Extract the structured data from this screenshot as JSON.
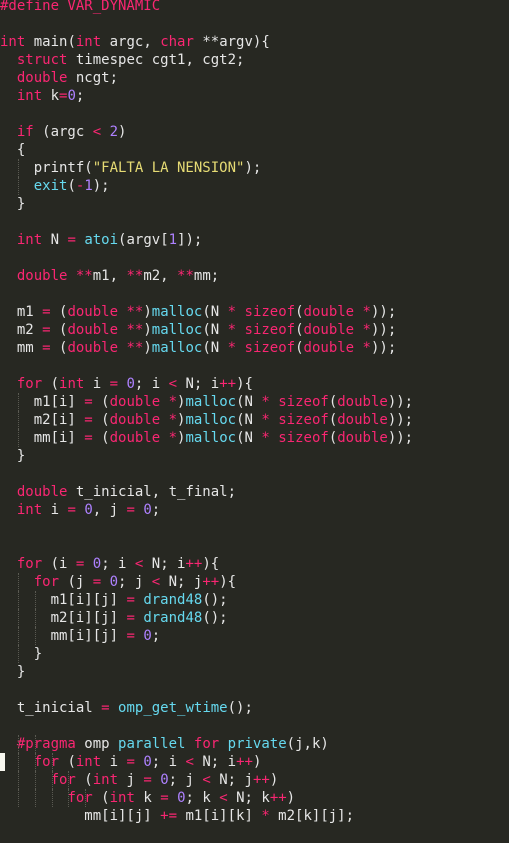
{
  "editor": {
    "theme_colors": {
      "background": "#272822",
      "text": "#e6e6e6",
      "keyword": "#f92672",
      "string": "#e6db74",
      "number": "#ae81ff",
      "function": "#66d9ef"
    },
    "lines": [
      {
        "c": "p",
        "tokens": [
          [
            "p",
            "#define VAR_DYNAMIC"
          ]
        ]
      },
      {
        "c": "b",
        "tokens": []
      },
      {
        "c": "m",
        "tokens": [
          [
            "k",
            "int"
          ],
          [
            "t",
            " main("
          ],
          [
            "k",
            "int"
          ],
          [
            "t",
            " argc, "
          ],
          [
            "k",
            "char"
          ],
          [
            "t",
            " **argv){"
          ]
        ]
      },
      {
        "c": "d",
        "tokens": [
          [
            "t",
            "  "
          ],
          [
            "k",
            "struct"
          ],
          [
            "t",
            " timespec cgt1, cgt2;"
          ]
        ]
      },
      {
        "c": "d",
        "tokens": [
          [
            "t",
            "  "
          ],
          [
            "k",
            "double"
          ],
          [
            "t",
            " ncgt;"
          ]
        ]
      },
      {
        "c": "d",
        "tokens": [
          [
            "t",
            "  "
          ],
          [
            "k",
            "int"
          ],
          [
            "t",
            " k"
          ],
          [
            "k",
            "="
          ],
          [
            "n",
            "0"
          ],
          [
            "t",
            ";"
          ]
        ]
      },
      {
        "c": "b",
        "tokens": []
      },
      {
        "c": "i",
        "tokens": [
          [
            "t",
            "  "
          ],
          [
            "k",
            "if"
          ],
          [
            "t",
            " (argc "
          ],
          [
            "k",
            "<"
          ],
          [
            "t",
            " "
          ],
          [
            "n",
            "2"
          ],
          [
            "t",
            ")"
          ]
        ]
      },
      {
        "c": "i",
        "tokens": [
          [
            "t",
            "  {"
          ]
        ]
      },
      {
        "c": "i",
        "tokens": [
          [
            "t",
            "    printf("
          ],
          [
            "s",
            "\"FALTA LA NENSION\""
          ],
          [
            "t",
            ");"
          ]
        ]
      },
      {
        "c": "i",
        "tokens": [
          [
            "t",
            "    "
          ],
          [
            "f",
            "exit"
          ],
          [
            "t",
            "("
          ],
          [
            "k",
            "-"
          ],
          [
            "n",
            "1"
          ],
          [
            "t",
            ");"
          ]
        ]
      },
      {
        "c": "i",
        "tokens": [
          [
            "t",
            "  }"
          ]
        ]
      },
      {
        "c": "b",
        "tokens": []
      },
      {
        "c": "a",
        "tokens": [
          [
            "t",
            "  "
          ],
          [
            "k",
            "int"
          ],
          [
            "t",
            " N "
          ],
          [
            "k",
            "="
          ],
          [
            "t",
            " "
          ],
          [
            "f",
            "atoi"
          ],
          [
            "t",
            "(argv["
          ],
          [
            "n",
            "1"
          ],
          [
            "t",
            "]);"
          ]
        ]
      },
      {
        "c": "b",
        "tokens": []
      },
      {
        "c": "d",
        "tokens": [
          [
            "t",
            "  "
          ],
          [
            "k",
            "double"
          ],
          [
            "t",
            " "
          ],
          [
            "k",
            "**"
          ],
          [
            "t",
            "m1, "
          ],
          [
            "k",
            "**"
          ],
          [
            "t",
            "m2, "
          ],
          [
            "k",
            "**"
          ],
          [
            "t",
            "mm;"
          ]
        ]
      },
      {
        "c": "b",
        "tokens": []
      },
      {
        "c": "m",
        "tokens": [
          [
            "t",
            "  m1 "
          ],
          [
            "k",
            "="
          ],
          [
            "t",
            " ("
          ],
          [
            "k",
            "double"
          ],
          [
            "t",
            " "
          ],
          [
            "k",
            "**"
          ],
          [
            "t",
            ")"
          ],
          [
            "f",
            "malloc"
          ],
          [
            "t",
            "(N "
          ],
          [
            "k",
            "*"
          ],
          [
            "t",
            " "
          ],
          [
            "k",
            "sizeof"
          ],
          [
            "t",
            "("
          ],
          [
            "k",
            "double"
          ],
          [
            "t",
            " "
          ],
          [
            "k",
            "*"
          ],
          [
            "t",
            "));"
          ]
        ]
      },
      {
        "c": "m",
        "tokens": [
          [
            "t",
            "  m2 "
          ],
          [
            "k",
            "="
          ],
          [
            "t",
            " ("
          ],
          [
            "k",
            "double"
          ],
          [
            "t",
            " "
          ],
          [
            "k",
            "**"
          ],
          [
            "t",
            ")"
          ],
          [
            "f",
            "malloc"
          ],
          [
            "t",
            "(N "
          ],
          [
            "k",
            "*"
          ],
          [
            "t",
            " "
          ],
          [
            "k",
            "sizeof"
          ],
          [
            "t",
            "("
          ],
          [
            "k",
            "double"
          ],
          [
            "t",
            " "
          ],
          [
            "k",
            "*"
          ],
          [
            "t",
            "));"
          ]
        ]
      },
      {
        "c": "m",
        "tokens": [
          [
            "t",
            "  mm "
          ],
          [
            "k",
            "="
          ],
          [
            "t",
            " ("
          ],
          [
            "k",
            "double"
          ],
          [
            "t",
            " "
          ],
          [
            "k",
            "**"
          ],
          [
            "t",
            ")"
          ],
          [
            "f",
            "malloc"
          ],
          [
            "t",
            "(N "
          ],
          [
            "k",
            "*"
          ],
          [
            "t",
            " "
          ],
          [
            "k",
            "sizeof"
          ],
          [
            "t",
            "("
          ],
          [
            "k",
            "double"
          ],
          [
            "t",
            " "
          ],
          [
            "k",
            "*"
          ],
          [
            "t",
            "));"
          ]
        ]
      },
      {
        "c": "b",
        "tokens": []
      },
      {
        "c": "l",
        "tokens": [
          [
            "t",
            "  "
          ],
          [
            "k",
            "for"
          ],
          [
            "t",
            " ("
          ],
          [
            "k",
            "int"
          ],
          [
            "t",
            " i "
          ],
          [
            "k",
            "="
          ],
          [
            "t",
            " "
          ],
          [
            "n",
            "0"
          ],
          [
            "t",
            "; i "
          ],
          [
            "k",
            "<"
          ],
          [
            "t",
            " N; i"
          ],
          [
            "k",
            "++"
          ],
          [
            "t",
            "){"
          ]
        ]
      },
      {
        "c": "m",
        "tokens": [
          [
            "t",
            "    m1[i] "
          ],
          [
            "k",
            "="
          ],
          [
            "t",
            " ("
          ],
          [
            "k",
            "double"
          ],
          [
            "t",
            " "
          ],
          [
            "k",
            "*"
          ],
          [
            "t",
            ")"
          ],
          [
            "f",
            "malloc"
          ],
          [
            "t",
            "(N "
          ],
          [
            "k",
            "*"
          ],
          [
            "t",
            " "
          ],
          [
            "k",
            "sizeof"
          ],
          [
            "t",
            "("
          ],
          [
            "k",
            "double"
          ],
          [
            "t",
            "));"
          ]
        ]
      },
      {
        "c": "m",
        "tokens": [
          [
            "t",
            "    m2[i] "
          ],
          [
            "k",
            "="
          ],
          [
            "t",
            " ("
          ],
          [
            "k",
            "double"
          ],
          [
            "t",
            " "
          ],
          [
            "k",
            "*"
          ],
          [
            "t",
            ")"
          ],
          [
            "f",
            "malloc"
          ],
          [
            "t",
            "(N "
          ],
          [
            "k",
            "*"
          ],
          [
            "t",
            " "
          ],
          [
            "k",
            "sizeof"
          ],
          [
            "t",
            "("
          ],
          [
            "k",
            "double"
          ],
          [
            "t",
            "));"
          ]
        ]
      },
      {
        "c": "m",
        "tokens": [
          [
            "t",
            "    mm[i] "
          ],
          [
            "k",
            "="
          ],
          [
            "t",
            " ("
          ],
          [
            "k",
            "double"
          ],
          [
            "t",
            " "
          ],
          [
            "k",
            "*"
          ],
          [
            "t",
            ")"
          ],
          [
            "f",
            "malloc"
          ],
          [
            "t",
            "(N "
          ],
          [
            "k",
            "*"
          ],
          [
            "t",
            " "
          ],
          [
            "k",
            "sizeof"
          ],
          [
            "t",
            "("
          ],
          [
            "k",
            "double"
          ],
          [
            "t",
            "));"
          ]
        ]
      },
      {
        "c": "l",
        "tokens": [
          [
            "t",
            "  }"
          ]
        ]
      },
      {
        "c": "b",
        "tokens": []
      },
      {
        "c": "d",
        "tokens": [
          [
            "t",
            "  "
          ],
          [
            "k",
            "double"
          ],
          [
            "t",
            " t_inicial, t_final;"
          ]
        ]
      },
      {
        "c": "d",
        "tokens": [
          [
            "t",
            "  "
          ],
          [
            "k",
            "int"
          ],
          [
            "t",
            " i "
          ],
          [
            "k",
            "="
          ],
          [
            "t",
            " "
          ],
          [
            "n",
            "0"
          ],
          [
            "t",
            ", j "
          ],
          [
            "k",
            "="
          ],
          [
            "t",
            " "
          ],
          [
            "n",
            "0"
          ],
          [
            "t",
            ";"
          ]
        ]
      },
      {
        "c": "b",
        "tokens": []
      },
      {
        "c": "b",
        "tokens": []
      },
      {
        "c": "l",
        "tokens": [
          [
            "t",
            "  "
          ],
          [
            "k",
            "for"
          ],
          [
            "t",
            " (i "
          ],
          [
            "k",
            "="
          ],
          [
            "t",
            " "
          ],
          [
            "n",
            "0"
          ],
          [
            "t",
            "; i "
          ],
          [
            "k",
            "<"
          ],
          [
            "t",
            " N; i"
          ],
          [
            "k",
            "++"
          ],
          [
            "t",
            "){"
          ]
        ]
      },
      {
        "c": "l",
        "tokens": [
          [
            "t",
            "    "
          ],
          [
            "k",
            "for"
          ],
          [
            "t",
            " (j "
          ],
          [
            "k",
            "="
          ],
          [
            "t",
            " "
          ],
          [
            "n",
            "0"
          ],
          [
            "t",
            "; j "
          ],
          [
            "k",
            "<"
          ],
          [
            "t",
            " N; j"
          ],
          [
            "k",
            "++"
          ],
          [
            "t",
            "){"
          ]
        ]
      },
      {
        "c": "a",
        "tokens": [
          [
            "t",
            "      m1[i][j] "
          ],
          [
            "k",
            "="
          ],
          [
            "t",
            " "
          ],
          [
            "f",
            "drand48"
          ],
          [
            "t",
            "();"
          ]
        ]
      },
      {
        "c": "a",
        "tokens": [
          [
            "t",
            "      m2[i][j] "
          ],
          [
            "k",
            "="
          ],
          [
            "t",
            " "
          ],
          [
            "f",
            "drand48"
          ],
          [
            "t",
            "();"
          ]
        ]
      },
      {
        "c": "a",
        "tokens": [
          [
            "t",
            "      mm[i][j] "
          ],
          [
            "k",
            "="
          ],
          [
            "t",
            " "
          ],
          [
            "n",
            "0"
          ],
          [
            "t",
            ";"
          ]
        ]
      },
      {
        "c": "l",
        "tokens": [
          [
            "t",
            "    }"
          ]
        ]
      },
      {
        "c": "l",
        "tokens": [
          [
            "t",
            "  }"
          ]
        ]
      },
      {
        "c": "b",
        "tokens": []
      },
      {
        "c": "a",
        "tokens": [
          [
            "t",
            "  t_inicial "
          ],
          [
            "k",
            "="
          ],
          [
            "t",
            " "
          ],
          [
            "f",
            "omp_get_wtime"
          ],
          [
            "t",
            "();"
          ]
        ]
      },
      {
        "c": "b",
        "tokens": []
      },
      {
        "c": "p",
        "tokens": [
          [
            "t",
            "  "
          ],
          [
            "p",
            "#pragma"
          ],
          [
            "t",
            " omp "
          ],
          [
            "f",
            "parallel"
          ],
          [
            "t",
            " "
          ],
          [
            "k",
            "for"
          ],
          [
            "t",
            " "
          ],
          [
            "f",
            "private"
          ],
          [
            "t",
            "(j,k)"
          ]
        ]
      },
      {
        "c": "l",
        "tokens": [
          [
            "t",
            "    "
          ],
          [
            "k",
            "for"
          ],
          [
            "t",
            " ("
          ],
          [
            "k",
            "int"
          ],
          [
            "t",
            " i "
          ],
          [
            "k",
            "="
          ],
          [
            "t",
            " "
          ],
          [
            "n",
            "0"
          ],
          [
            "t",
            "; i "
          ],
          [
            "k",
            "<"
          ],
          [
            "t",
            " N; i"
          ],
          [
            "k",
            "++"
          ],
          [
            "t",
            ")"
          ]
        ]
      },
      {
        "c": "l",
        "tokens": [
          [
            "t",
            "      "
          ],
          [
            "k",
            "for"
          ],
          [
            "t",
            " ("
          ],
          [
            "k",
            "int"
          ],
          [
            "t",
            " j "
          ],
          [
            "k",
            "="
          ],
          [
            "t",
            " "
          ],
          [
            "n",
            "0"
          ],
          [
            "t",
            "; j "
          ],
          [
            "k",
            "<"
          ],
          [
            "t",
            " N; j"
          ],
          [
            "k",
            "++"
          ],
          [
            "t",
            ")"
          ]
        ]
      },
      {
        "c": "l",
        "tokens": [
          [
            "t",
            "        "
          ],
          [
            "k",
            "for"
          ],
          [
            "t",
            " ("
          ],
          [
            "k",
            "int"
          ],
          [
            "t",
            " k "
          ],
          [
            "k",
            "="
          ],
          [
            "t",
            " "
          ],
          [
            "n",
            "0"
          ],
          [
            "t",
            "; k "
          ],
          [
            "k",
            "<"
          ],
          [
            "t",
            " N; k"
          ],
          [
            "k",
            "++"
          ],
          [
            "t",
            ")"
          ]
        ]
      },
      {
        "c": "a",
        "tokens": [
          [
            "t",
            "          mm[i][j] "
          ],
          [
            "k",
            "+="
          ],
          [
            "t",
            " m1[i][k] "
          ],
          [
            "k",
            "*"
          ],
          [
            "t",
            " m2[k][j];"
          ]
        ]
      }
    ]
  }
}
